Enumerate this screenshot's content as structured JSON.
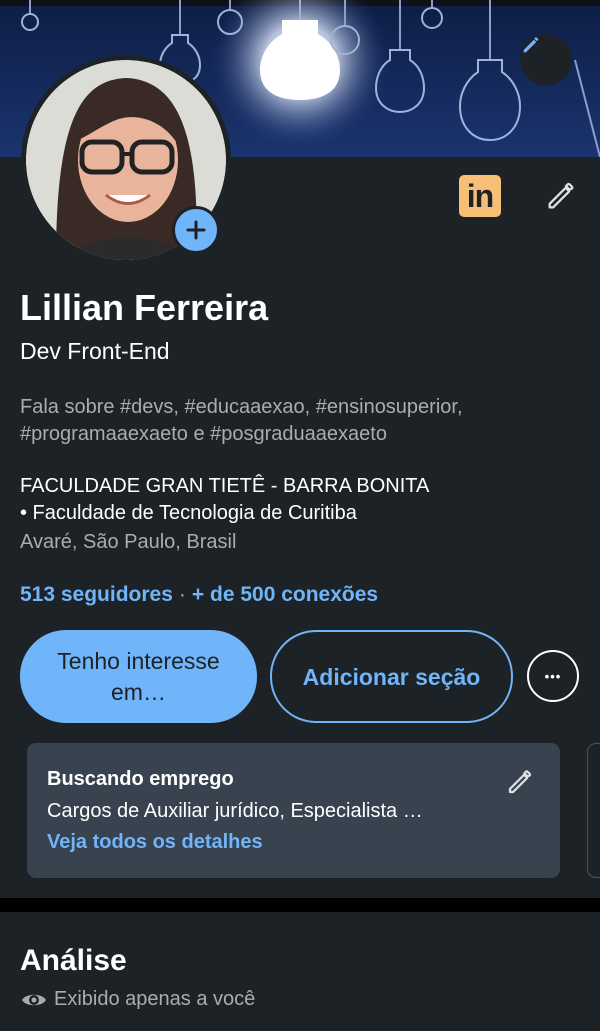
{
  "profile": {
    "name": "Lillian Ferreira",
    "headline": "Dev Front-End",
    "talks_about": "Fala sobre #devs, #educaaexao, #ensinosuperior, #programaaexaeto e #posgraduaaexaeto",
    "education_line1": "FACULDADE GRAN TIETÊ - BARRA BONITA",
    "education_line2": "• Faculdade de Tecnologia de Curitiba",
    "location": "Avaré, São Paulo, Brasil",
    "followers": "513 seguidores",
    "separator": "·",
    "connections": "+ de 500 conexões"
  },
  "badges": {
    "linkedin_text": "in"
  },
  "actions": {
    "primary_label": "Tenho interesse em…",
    "add_section_label": "Adicionar seção",
    "more_label": "•••"
  },
  "open_to_work": {
    "title": "Buscando emprego",
    "description": "Cargos de Auxiliar jurídico, Especialista …",
    "link": "Veja todos os detalhes"
  },
  "analytics": {
    "title": "Análise",
    "visibility": "Exibido apenas a você"
  },
  "colors": {
    "background": "#1d2226",
    "accent": "#70b5f9",
    "card": "#38434f",
    "linkedin_badge": "#f5c075",
    "muted_text": "#a9adb1"
  }
}
